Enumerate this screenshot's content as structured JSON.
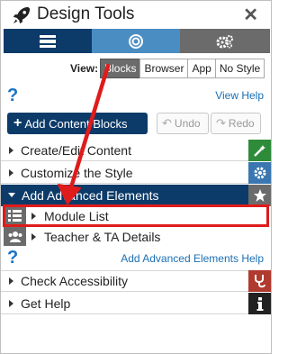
{
  "title": "Design Tools",
  "close_glyph": "✕",
  "tabs": [
    {
      "icon": "layout-list-icon",
      "active": true
    },
    {
      "icon": "target-icon"
    },
    {
      "icon": "gears-icon"
    }
  ],
  "view": {
    "label": "View:",
    "options": [
      "Blocks",
      "Browser",
      "App",
      "No Style"
    ],
    "selected": "Blocks"
  },
  "help_glyph": "?",
  "view_help": "View Help",
  "add_content_blocks": "Add Content Blocks",
  "undo": "Undo",
  "redo": "Redo",
  "sections": {
    "create_edit": "Create/Edit Content",
    "customize": "Customize the Style",
    "advanced": "Add Advanced Elements",
    "accessibility": "Check Accessibility",
    "get_help": "Get Help"
  },
  "advanced_items": {
    "module_list": "Module List",
    "teacher_details": "Teacher & TA Details"
  },
  "advanced_help": "Add Advanced Elements Help",
  "colors": {
    "navy": "#0d3b69",
    "tab_blue": "#4a8dc2",
    "tab_gray": "#6b6b6b",
    "highlight_red": "#e01b1b",
    "link_blue": "#1a6fb5"
  }
}
